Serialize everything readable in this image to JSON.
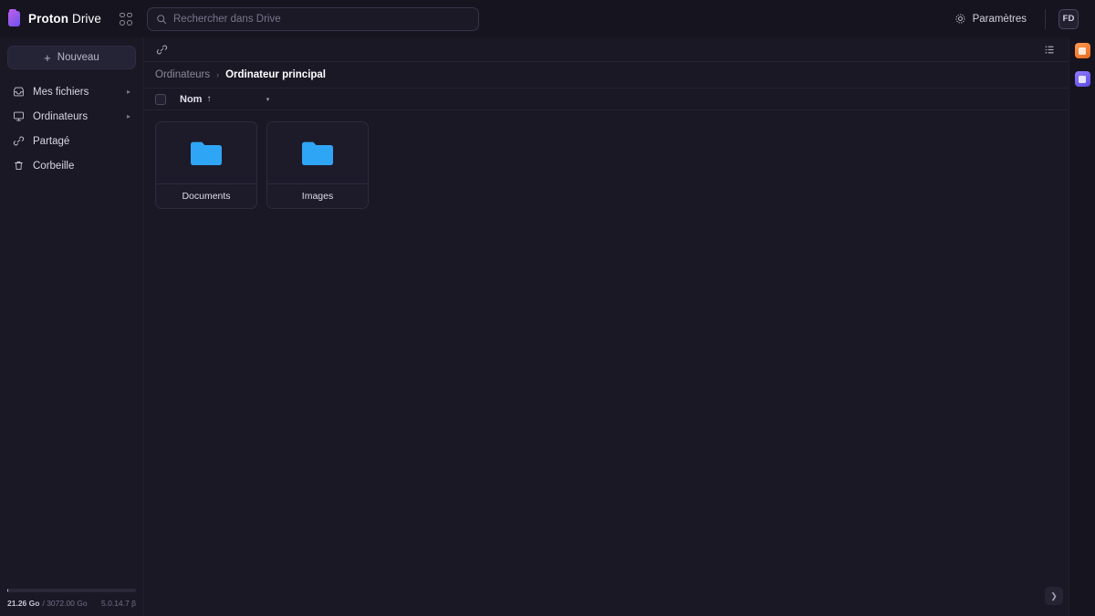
{
  "brand": {
    "name_bold": "Proton",
    "name_thin": "Drive"
  },
  "topbar": {
    "apps_icon": "apps-grid-icon",
    "search": {
      "placeholder": "Rechercher dans Drive",
      "value": ""
    },
    "settings_label": "Paramètres",
    "settings_icon": "gear-icon",
    "avatar_initials": "FD"
  },
  "sidebar": {
    "new_button": {
      "label": "Nouveau",
      "icon": "plus-icon"
    },
    "items": [
      {
        "label": "Mes fichiers",
        "icon": "inbox-icon",
        "chevron": "▸",
        "has_chevron": true
      },
      {
        "label": "Ordinateurs",
        "icon": "monitor-icon",
        "chevron": "▸",
        "has_chevron": true
      },
      {
        "label": "Partagé",
        "icon": "link-icon",
        "has_chevron": false
      },
      {
        "label": "Corbeille",
        "icon": "trash-icon",
        "has_chevron": false
      }
    ],
    "storage": {
      "used": "21.26 Go",
      "separator": "/",
      "total": "3072.00 Go",
      "percent": 0.7,
      "version": "5.0.14.7 β"
    }
  },
  "toolbar": {
    "link_icon": "link-icon",
    "view_toggle_icon": "list-view-icon"
  },
  "breadcrumb": {
    "parent": "Ordinateurs",
    "separator": "›",
    "current": "Ordinateur principal"
  },
  "list_header": {
    "select_all": "select-all-checkbox",
    "name_column": "Nom",
    "sort_arrow": "↑",
    "caret": "▾"
  },
  "items": [
    {
      "name": "Documents",
      "type": "folder",
      "color": "#2fa5f5"
    },
    {
      "name": "Images",
      "type": "folder",
      "color": "#2fa5f5"
    }
  ],
  "expand_button": {
    "icon": "chevron-right-icon",
    "glyph": "❯"
  },
  "rail": {
    "apps": [
      {
        "name": "proton-calendar",
        "color": "#ef7a25"
      },
      {
        "name": "proton-drive",
        "color": "#6d5aea"
      }
    ]
  },
  "colors": {
    "background": "#16141f",
    "panel": "#1b1825",
    "border": "#2d2a3d",
    "accent_folder": "#2fa5f5",
    "brand_purple": "#8f5ae8",
    "text_primary": "#ffffff",
    "text_muted": "#8a8799"
  }
}
